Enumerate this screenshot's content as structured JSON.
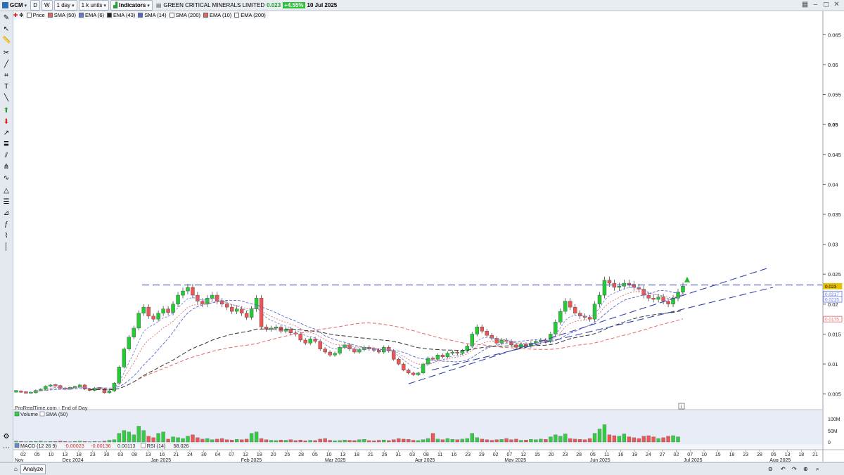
{
  "toolbar": {
    "symbol": "GCM",
    "timeframe": "1 day",
    "units": "1 k units",
    "indicators": "Indicators",
    "instrument_name": "GREEN CRITICAL MINERALS LIMITED",
    "last_price": "0.023",
    "change_pct": "+4.55%",
    "date": "10 Jul 2025",
    "btn_d": "D",
    "btn_w": "W"
  },
  "legend": {
    "items": [
      {
        "label": "Price",
        "color": "#ffffff"
      },
      {
        "label": "SMA (50)",
        "color": "#e06666"
      },
      {
        "label": "EMA (6)",
        "color": "#6677dd"
      },
      {
        "label": "EMA (43)",
        "color": "#222222"
      },
      {
        "label": "SMA (14)",
        "color": "#5566cc"
      },
      {
        "label": "SMA (200)",
        "color": "#ffffff"
      },
      {
        "label": "EMA (10)",
        "color": "#e06666"
      },
      {
        "label": "EMA (200)",
        "color": "#ffffff"
      }
    ]
  },
  "source_label": "ProRealTime.com - End of Day",
  "volume_legend": {
    "a": "Volume",
    "b": "SMA (50)"
  },
  "indicator_legend": {
    "macd_label": "MACD (12 26 9)",
    "macd_v1": "-0.00023",
    "macd_v2": "-0.00136",
    "macd_v3": "0.00113",
    "rsi_label": "RSI (14)",
    "rsi_value": "58.026"
  },
  "bottom": {
    "analyze": "Analyze"
  },
  "colors": {
    "up": "#22cc33",
    "down": "#ee5555",
    "bg": "#ffffff",
    "hline": "#3344aa"
  },
  "chart_data": {
    "type": "candlestick",
    "y_axis": {
      "ticks": [
        "0.065",
        "0.06",
        "0.055",
        "0.05",
        "0.045",
        "0.04",
        "0.035",
        "0.03",
        "0.025",
        "0.02",
        "0.015",
        "0.01",
        "0.005"
      ],
      "range": [
        0.0025,
        0.0675
      ]
    },
    "volume_axis": {
      "ticks": [
        "100M",
        "50M",
        "0"
      ]
    },
    "price_tags": [
      {
        "value": "0.023",
        "color": "#e8c200"
      },
      {
        "value": "0.0217",
        "color": "#6677dd"
      },
      {
        "value": "0.0215",
        "color": "#6677dd"
      },
      {
        "value": "0.0175",
        "color": "#e06666"
      }
    ],
    "x_day_labels": [
      "02",
      "05",
      "10",
      "13",
      "18",
      "23",
      "30",
      "03",
      "08",
      "13",
      "16",
      "21",
      "24",
      "30",
      "04",
      "07",
      "12",
      "18",
      "20",
      "25",
      "28",
      "05",
      "10",
      "13",
      "18",
      "21",
      "26",
      "31",
      "03",
      "08",
      "11",
      "16",
      "23",
      "29",
      "02",
      "07",
      "12",
      "15",
      "20",
      "23",
      "28",
      "05",
      "11",
      "16",
      "19",
      "24",
      "27",
      "02",
      "07",
      "10",
      "15",
      "18",
      "23",
      "28",
      "05",
      "13",
      "18",
      "21"
    ],
    "x_month_labels": [
      {
        "label": "Nov",
        "pos": 0.0
      },
      {
        "label": "Dec 2024",
        "pos": 0.072
      },
      {
        "label": "Jan 2025",
        "pos": 0.181
      },
      {
        "label": "Feb 2025",
        "pos": 0.293
      },
      {
        "label": "Mar 2025",
        "pos": 0.397
      },
      {
        "label": "Apr 2025",
        "pos": 0.508
      },
      {
        "label": "May 2025",
        "pos": 0.62
      },
      {
        "label": "Jun 2025",
        "pos": 0.725
      },
      {
        "label": "Jul 2025",
        "pos": 0.84
      },
      {
        "label": "Aug 2025",
        "pos": 0.948
      }
    ],
    "close_path": [
      0.0055,
      0.0053,
      0.0052,
      0.0052,
      0.0056,
      0.0058,
      0.0063,
      0.0065,
      0.0064,
      0.006,
      0.0058,
      0.0061,
      0.0062,
      0.0065,
      0.0058,
      0.0056,
      0.006,
      0.0059,
      0.0052,
      0.0055,
      0.0068,
      0.0095,
      0.0125,
      0.0145,
      0.016,
      0.0185,
      0.0195,
      0.018,
      0.0175,
      0.0185,
      0.0192,
      0.0186,
      0.02,
      0.0215,
      0.0222,
      0.0228,
      0.0215,
      0.0205,
      0.02,
      0.021,
      0.0215,
      0.0205,
      0.02,
      0.0195,
      0.0188,
      0.0192,
      0.0185,
      0.0178,
      0.0192,
      0.021,
      0.0162,
      0.0158,
      0.016,
      0.0162,
      0.0155,
      0.0158,
      0.0152,
      0.015,
      0.014,
      0.0135,
      0.0142,
      0.0138,
      0.0125,
      0.012,
      0.0115,
      0.0118,
      0.0128,
      0.0132,
      0.0125,
      0.012,
      0.0124,
      0.0128,
      0.0125,
      0.0123,
      0.012,
      0.0128,
      0.0122,
      0.0108,
      0.01,
      0.009,
      0.0085,
      0.0082,
      0.0085,
      0.01,
      0.011,
      0.0108,
      0.0115,
      0.0112,
      0.0118,
      0.012,
      0.0118,
      0.0122,
      0.013,
      0.015,
      0.0162,
      0.0155,
      0.0148,
      0.0143,
      0.0135,
      0.014,
      0.0138,
      0.0132,
      0.0128,
      0.0133,
      0.013,
      0.0135,
      0.0138,
      0.014,
      0.0138,
      0.015,
      0.017,
      0.0188,
      0.0205,
      0.0195,
      0.0185,
      0.018,
      0.0178,
      0.0175,
      0.02,
      0.0215,
      0.024,
      0.0235,
      0.0228,
      0.023,
      0.0235,
      0.0233,
      0.0228,
      0.0225,
      0.0215,
      0.021,
      0.0208,
      0.0212,
      0.0205,
      0.02,
      0.021,
      0.022,
      0.023
    ],
    "volumes": [
      3,
      2,
      1,
      2,
      2,
      3,
      1,
      2,
      2,
      3,
      2,
      1,
      2,
      3,
      2,
      1,
      2,
      1,
      3,
      6,
      8,
      30,
      40,
      35,
      25,
      55,
      40,
      20,
      15,
      30,
      35,
      10,
      18,
      15,
      12,
      20,
      25,
      15,
      10,
      12,
      8,
      10,
      12,
      8,
      7,
      9,
      8,
      10,
      30,
      35,
      12,
      8,
      6,
      5,
      7,
      6,
      8,
      5,
      7,
      4,
      6,
      5,
      10,
      12,
      6,
      4,
      5,
      7,
      6,
      5,
      8,
      9,
      5,
      4,
      6,
      7,
      5,
      8,
      12,
      10,
      9,
      6,
      5,
      8,
      12,
      30,
      10,
      8,
      12,
      9,
      8,
      10,
      12,
      30,
      15,
      10,
      8,
      6,
      8,
      9,
      12,
      8,
      10,
      6,
      7,
      9,
      8,
      10,
      9,
      18,
      25,
      20,
      28,
      12,
      10,
      9,
      8,
      12,
      30,
      45,
      60,
      25,
      22,
      20,
      28,
      18,
      15,
      12,
      20,
      22,
      18,
      12,
      15,
      20,
      22,
      18
    ],
    "hline": 0.0232
  }
}
